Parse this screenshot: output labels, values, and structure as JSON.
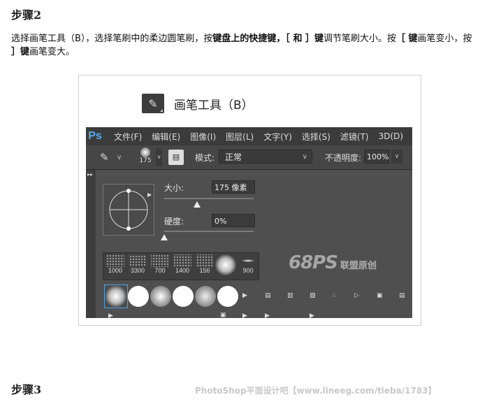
{
  "step2": {
    "title": "步骤2"
  },
  "instruction": {
    "t1": "选择画笔工具（B），选择笔刷中的柔边圆笔刷，按",
    "b1": "键盘上的快捷键，［ 和 ］键",
    "t2": "调节笔刷大小。按",
    "b2": "［ 键",
    "t3": "画笔变小，按",
    "b3": " ］键",
    "t4": "画笔变大。"
  },
  "tool": {
    "name": "画笔工具（B）",
    "icon": "brush-icon"
  },
  "ps_menu": [
    "文件(F)",
    "编辑(E)",
    "图像(I)",
    "图层(L)",
    "文字(Y)",
    "选择(S)",
    "滤镜(T)",
    "3D(D)"
  ],
  "ps_logo": "Ps",
  "options_bar": {
    "brush_size": "175",
    "mode_label": "模式:",
    "mode_value": "正常",
    "opacity_label": "不透明度:",
    "opacity_value": "100%"
  },
  "brush_popup": {
    "size_label": "大小:",
    "size_value": "175 像素",
    "size_fraction": 0.37,
    "hardness_label": "硬度:",
    "hardness_value": "0%",
    "hardness_fraction": 0.0
  },
  "presets": [
    "1000",
    "3300",
    "700",
    "1400",
    "156",
    "",
    "900"
  ],
  "watermark": {
    "text": "68PS",
    "cn": "联盟原创"
  },
  "step3": {
    "title": "步骤3"
  },
  "credit": "PhotoShop平面设计吧【www.lineeg.com/tieba/1783】"
}
